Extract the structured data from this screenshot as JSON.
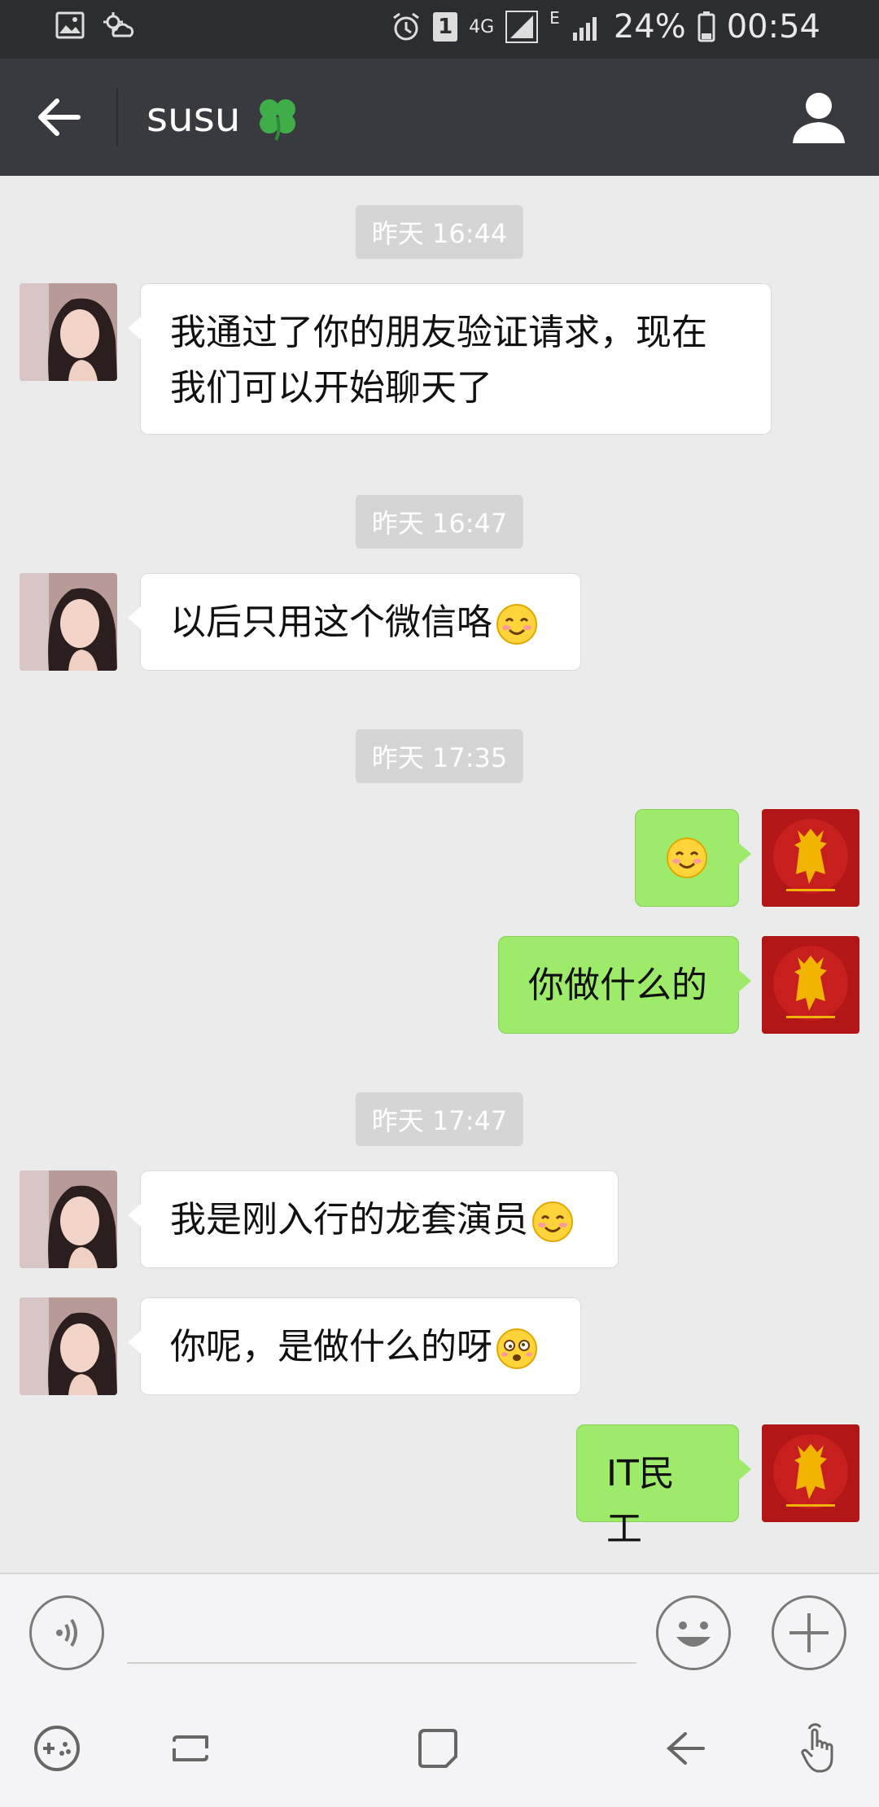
{
  "status_bar": {
    "battery": "24%",
    "time": "00:54",
    "network": "4G",
    "sim_badge": "1",
    "data_type": "E"
  },
  "header": {
    "title": "susu",
    "title_icon": "four-leaf-clover-icon"
  },
  "messages": [
    {
      "type": "timestamp",
      "text": "昨天 16:44"
    },
    {
      "type": "incoming",
      "text": "我通过了你的朋友验证请求，现在我们可以开始聊天了"
    },
    {
      "type": "timestamp",
      "text": "昨天 16:47"
    },
    {
      "type": "incoming",
      "text": "以后只用这个微信咯",
      "emoji": "blush-smile"
    },
    {
      "type": "timestamp",
      "text": "昨天 17:35"
    },
    {
      "type": "outgoing",
      "text": "",
      "emoji": "blush-smile"
    },
    {
      "type": "outgoing",
      "text": "你做什么的"
    },
    {
      "type": "timestamp",
      "text": "昨天 17:47"
    },
    {
      "type": "incoming",
      "text": "我是刚入行的龙套演员",
      "emoji": "blush-smile"
    },
    {
      "type": "incoming",
      "text": "你呢，是做什么的呀",
      "emoji": "dizzy-face"
    },
    {
      "type": "outgoing",
      "text": "IT民工"
    }
  ],
  "input": {
    "value": "",
    "placeholder": ""
  },
  "colors": {
    "outgoing_bubble": "#9eea6a",
    "incoming_bubble": "#ffffff",
    "header_bg": "#393a3f",
    "chat_bg": "#ebebeb"
  }
}
